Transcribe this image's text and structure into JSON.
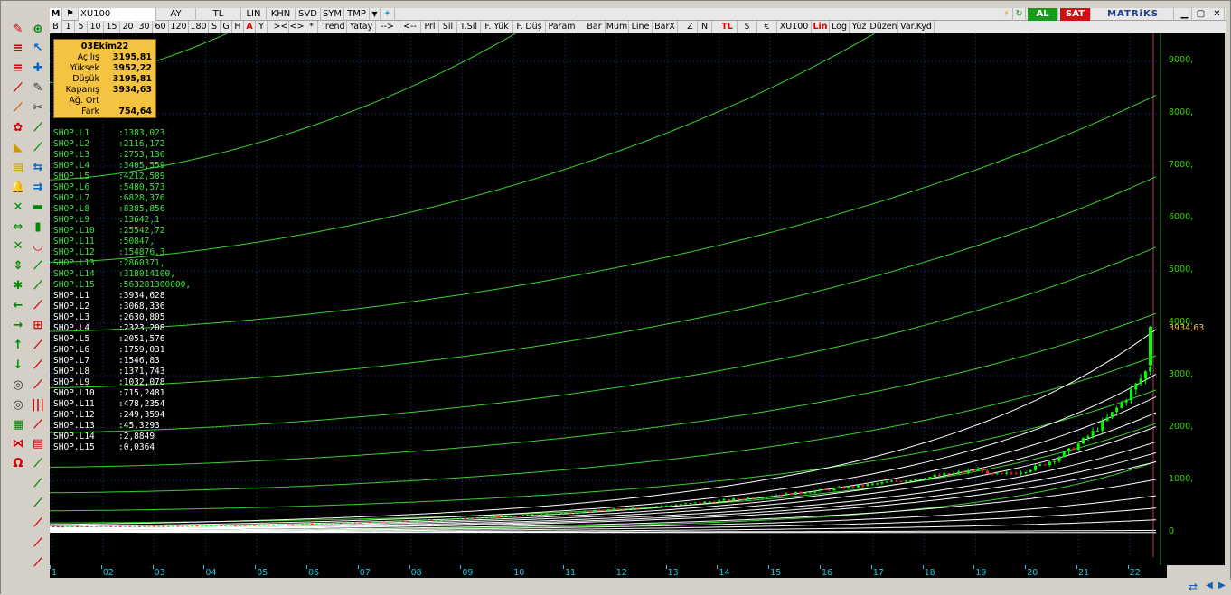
{
  "toolbar_top": {
    "menu_label": "M",
    "symbol": "XU100",
    "period": "AY",
    "currency": "TL",
    "scale": "LIN",
    "buttons": [
      "KHN",
      "SVD",
      "SYM",
      "TMP"
    ],
    "buy_label": "AL",
    "sell_label": "SAT",
    "brand": "MATRiKS"
  },
  "toolbar_bottom": {
    "items": [
      "B",
      "1",
      "5",
      "10",
      "15",
      "20",
      "30",
      "60",
      "120",
      "180",
      "S",
      "G",
      "H",
      "A",
      "Y",
      "><",
      "<>",
      "*",
      "Trend",
      "Yatay",
      "-->",
      "<--",
      "Prl",
      "Sil",
      "T.Sil",
      "F. Yük",
      "F. Düş",
      "Param",
      "Bar",
      "Mum",
      "Line",
      "BarX",
      "Z",
      "N",
      "TL",
      "$",
      "€",
      "XU100",
      "Lin",
      "Log",
      "Yüz",
      "Düzen",
      "Var.Kyd"
    ],
    "active": [
      "A",
      "TL",
      "Lin"
    ]
  },
  "info_box": {
    "date": "03Ekim22",
    "rows": [
      {
        "label": "Açılış",
        "value": "3195,81"
      },
      {
        "label": "Yüksek",
        "value": "3952,22"
      },
      {
        "label": "Düşük",
        "value": "3195,81"
      },
      {
        "label": "Kapanış",
        "value": "3934,63"
      },
      {
        "label": "Ağ. Ort",
        "value": ""
      },
      {
        "label": "Fark",
        "value": "754,64"
      }
    ]
  },
  "levels_green": [
    {
      "name": "SHOP.L1",
      "value": ":1383,023"
    },
    {
      "name": "SHOP.L2",
      "value": ":2116,172"
    },
    {
      "name": "SHOP.L3",
      "value": ":2753,136"
    },
    {
      "name": "SHOP.L4",
      "value": ":3405,559"
    },
    {
      "name": "SHOP.L5",
      "value": ":4212,589"
    },
    {
      "name": "SHOP.L6",
      "value": ":5480,573"
    },
    {
      "name": "SHOP.L7",
      "value": ":6828,376"
    },
    {
      "name": "SHOP.L8",
      "value": ":8385,856"
    },
    {
      "name": "SHOP.L9",
      "value": ":13642,1"
    },
    {
      "name": "SHOP.L10",
      "value": ":25542,72"
    },
    {
      "name": "SHOP.L11",
      "value": ":50847,"
    },
    {
      "name": "SHOP.L12",
      "value": ":154876,3"
    },
    {
      "name": "SHOP.L13",
      "value": ":2860371,"
    },
    {
      "name": "SHOP.L14",
      "value": ":318014100,"
    },
    {
      "name": "SHOP.L15",
      "value": ":563281300000,"
    }
  ],
  "levels_white": [
    {
      "name": "SHOP.L1",
      "value": ":3934,628"
    },
    {
      "name": "SHOP.L2",
      "value": ":3068,336"
    },
    {
      "name": "SHOP.L3",
      "value": ":2630,805"
    },
    {
      "name": "SHOP.L4",
      "value": ":2323,208"
    },
    {
      "name": "SHOP.L5",
      "value": ":2051,576"
    },
    {
      "name": "SHOP.L6",
      "value": ":1759,031"
    },
    {
      "name": "SHOP.L7",
      "value": ":1546,83"
    },
    {
      "name": "SHOP.L8",
      "value": ":1371,743"
    },
    {
      "name": "SHOP.L9",
      "value": ":1032,078"
    },
    {
      "name": "SHOP.L10",
      "value": ":715,2481"
    },
    {
      "name": "SHOP.L11",
      "value": ":478,2354"
    },
    {
      "name": "SHOP.L12",
      "value": ":249,3594"
    },
    {
      "name": "SHOP.L13",
      "value": ":45,3293"
    },
    {
      "name": "SHOP.L14",
      "value": ":2,8849"
    },
    {
      "name": "SHOP.L15",
      "value": ":0,0364"
    }
  ],
  "last_price_label": "3934,63",
  "colors": {
    "background": "#000000",
    "green_curves": "#3ccf2e",
    "white_curves": "#ffffff",
    "axis_text": "#39d400",
    "x_axis_text": "#1fc8e0",
    "last_price": "#f5c342",
    "up_candle": "#00ff00",
    "down_candle": "#ff2020"
  },
  "chart_data": {
    "type": "candlestick",
    "y_ticks": [
      "9000,",
      "8000,",
      "7000,",
      "6000,",
      "5000,",
      "4000,",
      "3000,",
      "2000,",
      "1000,",
      "0"
    ],
    "ylim": [
      -200,
      9500
    ],
    "x_ticks": [
      "1",
      "02",
      "03",
      "04",
      "05",
      "06",
      "07",
      "08",
      "09",
      "10",
      "11",
      "12",
      "13",
      "14",
      "15",
      "16",
      "17",
      "18",
      "19",
      "20",
      "21",
      "22"
    ],
    "last_bar": {
      "date": "03Ekim22",
      "open": 3195.81,
      "high": 3952.22,
      "low": 3195.81,
      "close": 3934.63
    }
  }
}
